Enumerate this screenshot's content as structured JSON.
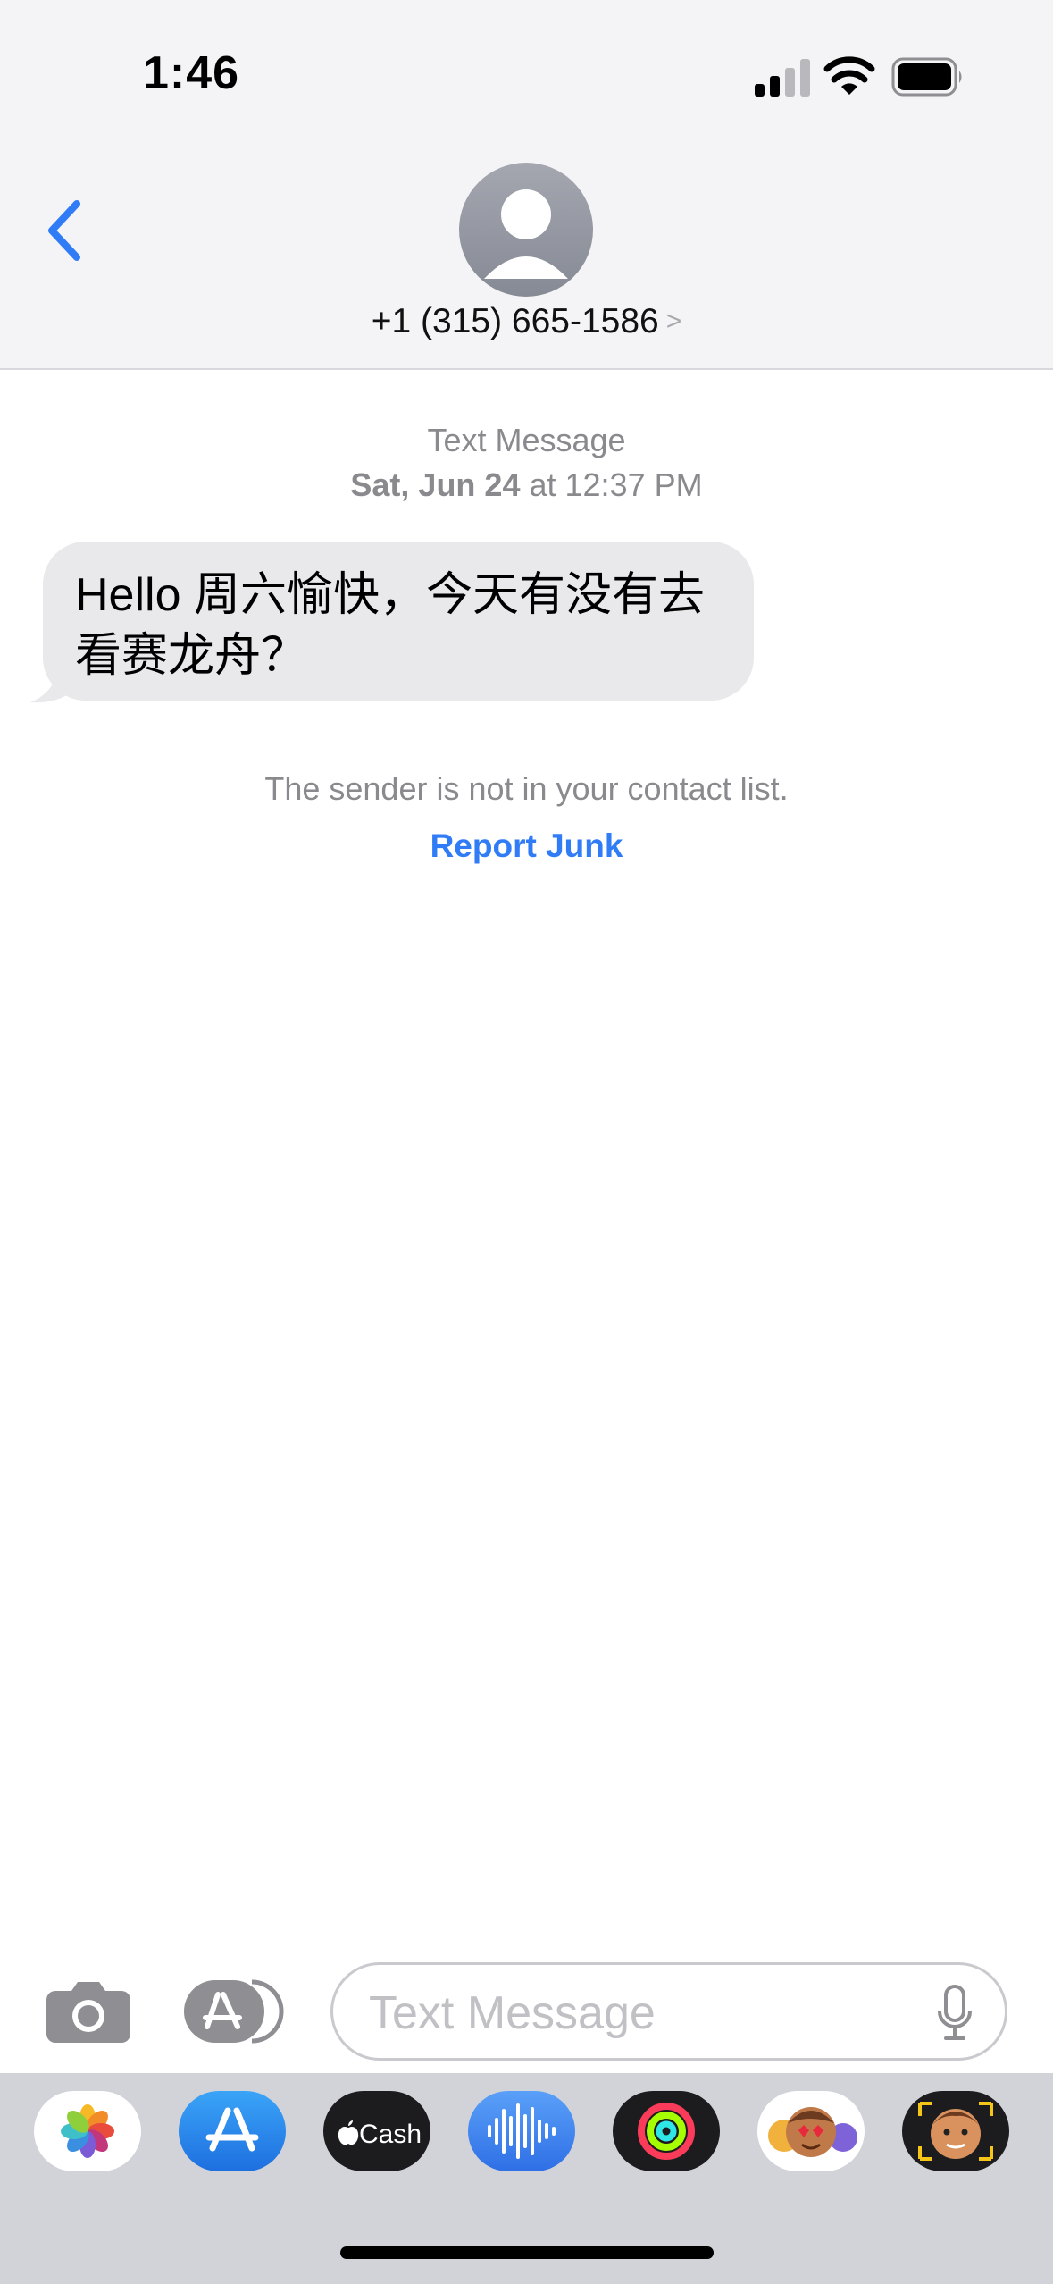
{
  "status_bar": {
    "time": "1:46"
  },
  "header": {
    "contact": "+1 (315) 665-1586"
  },
  "conversation": {
    "service_label": "Text Message",
    "date": "Sat, Jun 24",
    "time_suffix": "at 12:37 PM",
    "messages": [
      {
        "direction": "incoming",
        "text": "Hello 周六愉快，今天有没有去看赛龙舟？"
      }
    ],
    "sender_notice": "The sender is not in your contact list.",
    "report_junk": "Report Junk"
  },
  "composer": {
    "placeholder": "Text Message"
  },
  "app_drawer": {
    "apps": [
      "photos-icon",
      "app-store-icon",
      "apple-cash-icon",
      "audio-message-icon",
      "activity-icon",
      "memoji-stickers-icon",
      "memoji-icon"
    ],
    "apple_cash_label": "Cash"
  },
  "colors": {
    "accent": "#2F7CF6",
    "bubble_incoming": "#E9E9EB",
    "header_bg": "#F4F4F6",
    "drawer_bg": "#D1D3D9"
  }
}
